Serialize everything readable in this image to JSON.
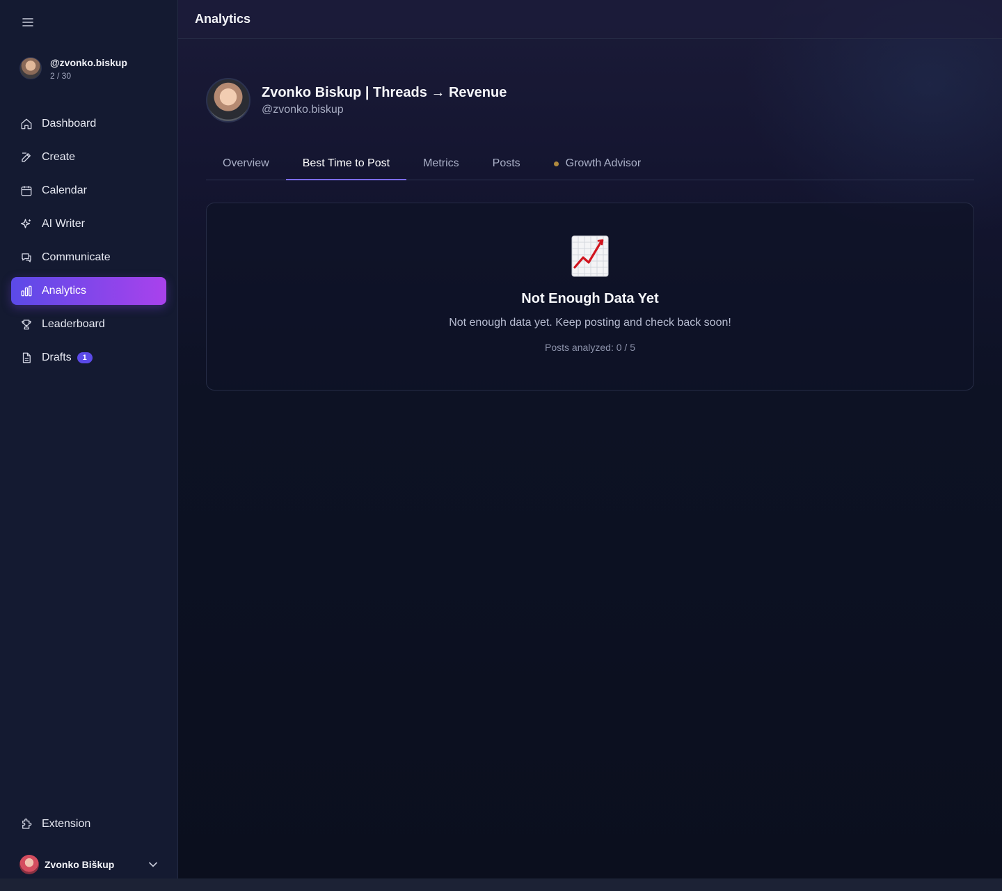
{
  "sidebar": {
    "menu_icon": "hamburger-icon",
    "account": {
      "handle": "@zvonko.biskup",
      "count": "2 / 30"
    },
    "items": [
      {
        "label": "Dashboard",
        "icon": "home-icon"
      },
      {
        "label": "Create",
        "icon": "edit-icon"
      },
      {
        "label": "Calendar",
        "icon": "calendar-icon"
      },
      {
        "label": "AI Writer",
        "icon": "sparkles-icon"
      },
      {
        "label": "Communicate",
        "icon": "chat-icon"
      },
      {
        "label": "Analytics",
        "icon": "bar-chart-icon",
        "active": true
      },
      {
        "label": "Leaderboard",
        "icon": "trophy-icon"
      },
      {
        "label": "Drafts",
        "icon": "document-icon",
        "badge": "1"
      }
    ],
    "extension": {
      "label": "Extension",
      "icon": "puzzle-icon"
    },
    "user": {
      "name": "Zvonko Biškup",
      "icon": "chevron-down-icon"
    }
  },
  "header": {
    "title": "Analytics"
  },
  "profile": {
    "name": "Zvonko Biskup | Threads → Revenue",
    "handle": "@zvonko.biskup"
  },
  "tabs": [
    {
      "label": "Overview"
    },
    {
      "label": "Best Time to Post",
      "active": true
    },
    {
      "label": "Metrics"
    },
    {
      "label": "Posts"
    },
    {
      "label": "Growth Advisor",
      "dot": true
    }
  ],
  "empty_state": {
    "icon": "chart-increasing-icon",
    "title": "Not Enough Data Yet",
    "description": "Not enough data yet. Keep posting and check back soon!",
    "meta": "Posts analyzed: 0 / 5"
  },
  "colors": {
    "accent_start": "#5b4ae8",
    "accent_end": "#a942ec",
    "tab_underline": "#7b6cf2",
    "advisor_dot": "#b08a3e"
  }
}
